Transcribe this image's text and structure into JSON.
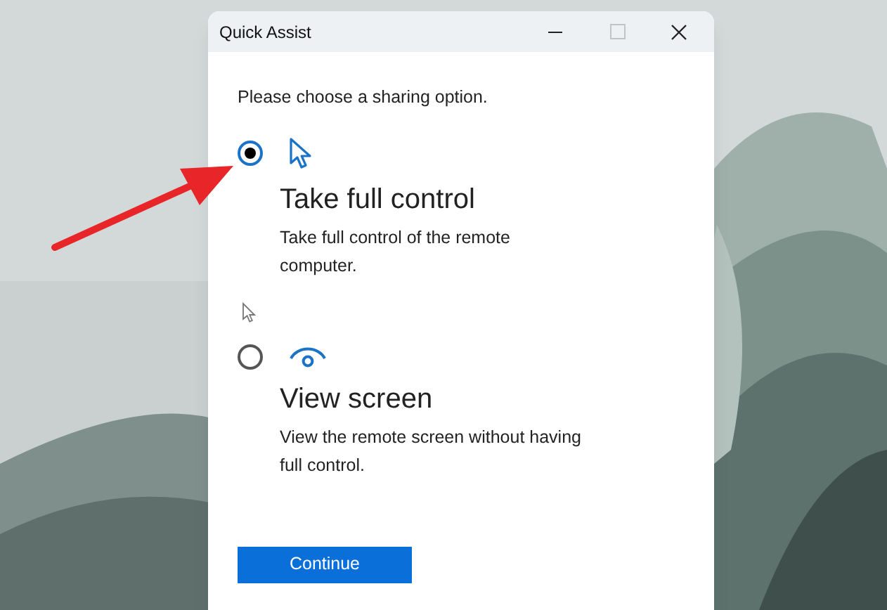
{
  "window": {
    "title": "Quick Assist"
  },
  "prompt": "Please choose a sharing option.",
  "options": [
    {
      "kind": "pointer",
      "selected": true,
      "title": "Take full control",
      "description": "Take full control of the remote computer."
    },
    {
      "kind": "eye",
      "selected": false,
      "title": "View screen",
      "description": "View the remote screen without having full control."
    }
  ],
  "button": "Continue"
}
